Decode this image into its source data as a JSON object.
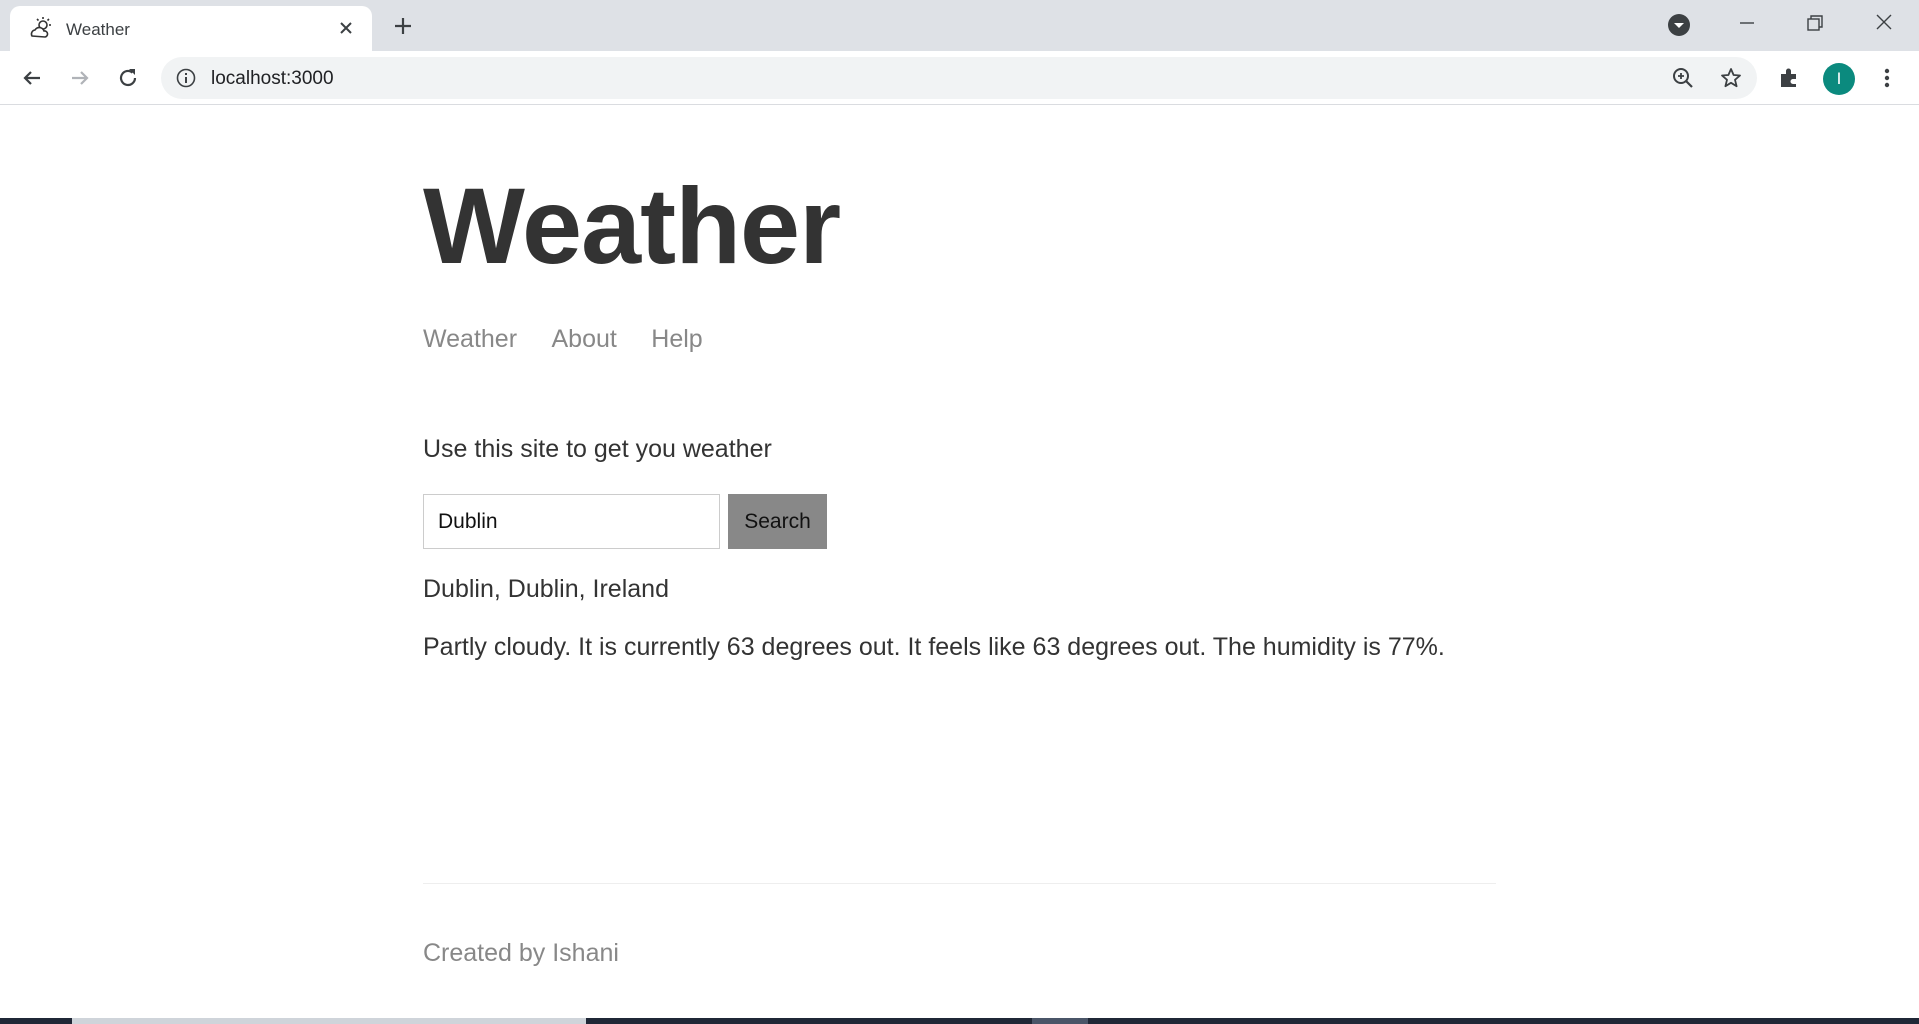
{
  "browser": {
    "tab_title": "Weather",
    "url": "localhost:3000",
    "profile_initial": "I",
    "profile_color": "#0b8a7e",
    "icons": [
      "weather-tab-icon",
      "tab-close-icon",
      "new-tab-icon",
      "tab-search-icon",
      "minimize-icon",
      "restore-icon",
      "window-close-icon",
      "back-icon",
      "forward-icon",
      "reload-icon",
      "site-info-icon",
      "zoom-icon",
      "bookmark-star-icon",
      "extensions-icon",
      "menu-icon"
    ]
  },
  "header": {
    "title": "Weather",
    "nav": [
      {
        "label": "Weather"
      },
      {
        "label": "About"
      },
      {
        "label": "Help"
      }
    ]
  },
  "main": {
    "intro": "Use this site to get you weather",
    "search": {
      "value": "Dublin",
      "button_label": "Search"
    },
    "result": {
      "location": "Dublin, Dublin, Ireland",
      "forecast": "Partly cloudy. It is currently 63 degrees out. It feels like 63 degrees out. The humidity is 77%."
    }
  },
  "footer": {
    "text": "Created by Ishani"
  },
  "colors": {
    "heading": "#333333",
    "muted": "#888888",
    "button_bg": "#888888"
  }
}
